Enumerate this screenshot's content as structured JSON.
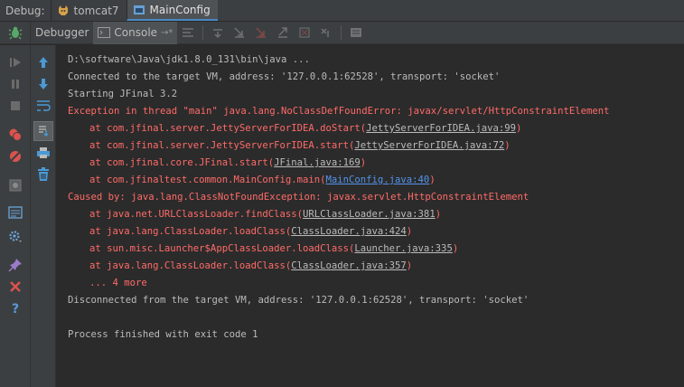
{
  "tabbar": {
    "debug_label": "Debug:",
    "tabs": [
      {
        "label": "tomcat7",
        "icon": "tomcat-icon"
      },
      {
        "label": "MainConfig",
        "icon": "app-config-icon"
      }
    ]
  },
  "toolbar": {
    "debugger_label": "Debugger",
    "console_label": "Console",
    "console_pin": "→*",
    "icons": [
      "show-execution-point-icon",
      "step-over-icon",
      "step-into-icon",
      "force-step-into-icon",
      "step-out-icon",
      "drop-frame-icon",
      "run-to-cursor-icon",
      "evaluate-expression-icon"
    ]
  },
  "left_controls": [
    "resume-icon",
    "pause-icon",
    "stop-icon",
    "view-breakpoints-icon",
    "mute-breakpoints-icon",
    "get-thread-dump-icon",
    "restore-layout-icon",
    "settings-icon",
    "pin-icon",
    "close-icon",
    "help-icon"
  ],
  "console_actions": [
    "scroll-up-icon",
    "scroll-down-icon",
    "soft-wrap-icon",
    "scroll-to-end-icon",
    "print-icon",
    "clear-all-icon"
  ],
  "colors": {
    "error": "#ff6b68",
    "link": "#5394ec",
    "text": "#bbbbbb",
    "background": "#2b2b2b"
  },
  "console": {
    "lines": [
      {
        "pre": "D:\\software\\Java\\jdk1.8.0_131\\bin\\java ...",
        "style": "normal"
      },
      {
        "pre": "Connected to the target VM, address: '127.0.0.1:62528', transport: 'socket'",
        "style": "normal"
      },
      {
        "pre": "Starting JFinal 3.2",
        "style": "normal"
      },
      {
        "pre": "Exception in thread \"main\" java.lang.NoClassDefFoundError: javax/servlet/HttpConstraintElement",
        "style": "err"
      },
      {
        "pre": "at com.jfinal.server.JettyServerForIDEA.doStart(",
        "link": "JettyServerForIDEA.java:99",
        "post": ")",
        "style": "err",
        "indent": true
      },
      {
        "pre": "at com.jfinal.server.JettyServerForIDEA.start(",
        "link": "JettyServerForIDEA.java:72",
        "post": ")",
        "style": "err",
        "indent": true
      },
      {
        "pre": "at com.jfinal.core.JFinal.start(",
        "link": "JFinal.java:169",
        "post": ")",
        "style": "err",
        "indent": true
      },
      {
        "pre": "at com.jfinaltest.common.MainConfig.main(",
        "link": "MainConfig.java:40",
        "post": ")",
        "style": "err",
        "indent": true,
        "link_blue": true
      },
      {
        "pre": "Caused by: java.lang.ClassNotFoundException: javax.servlet.HttpConstraintElement",
        "style": "err"
      },
      {
        "pre": "at java.net.URLClassLoader.findClass(",
        "link": "URLClassLoader.java:381",
        "post": ")",
        "style": "err",
        "indent": true
      },
      {
        "pre": "at java.lang.ClassLoader.loadClass(",
        "link": "ClassLoader.java:424",
        "post": ")",
        "style": "err",
        "indent": true
      },
      {
        "pre": "at sun.misc.Launcher$AppClassLoader.loadClass(",
        "link": "Launcher.java:335",
        "post": ")",
        "style": "err",
        "indent": true
      },
      {
        "pre": "at java.lang.ClassLoader.loadClass(",
        "link": "ClassLoader.java:357",
        "post": ")",
        "style": "err",
        "indent": true
      },
      {
        "pre": "... 4 more",
        "style": "err",
        "indent": true
      },
      {
        "pre": "Disconnected from the target VM, address: '127.0.0.1:62528', transport: 'socket'",
        "style": "normal"
      },
      {
        "pre": "",
        "style": "normal"
      },
      {
        "pre": "Process finished with exit code 1",
        "style": "normal"
      }
    ]
  }
}
